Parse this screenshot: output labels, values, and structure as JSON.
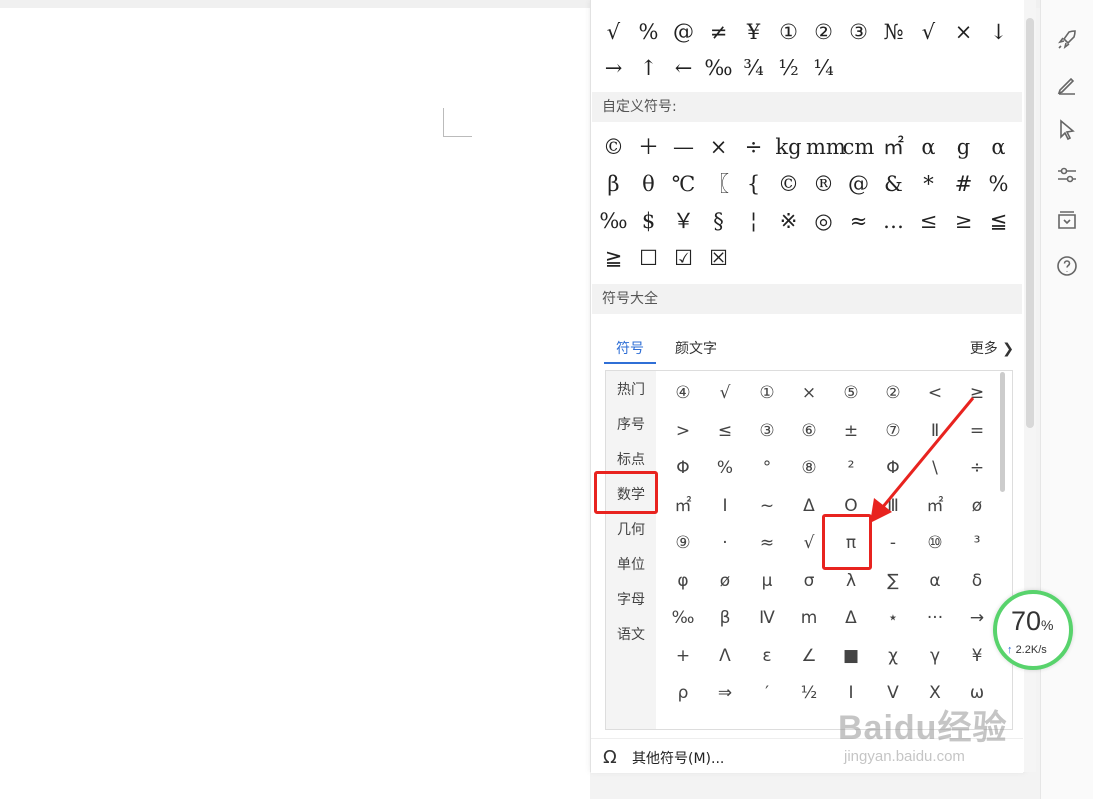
{
  "common_row1": [
    "√",
    "%",
    "@",
    "≠",
    "¥",
    "①",
    "②",
    "③",
    "№",
    "√",
    "×",
    "↓"
  ],
  "common_row2": [
    "→",
    "↑",
    "←",
    "‰",
    "¾",
    "½",
    "¼"
  ],
  "custom_section_title": "自定义符号:",
  "custom_rows": [
    [
      "©",
      "＋",
      "—",
      "×",
      "÷",
      "kg",
      "mm",
      "cm",
      "㎡",
      "α",
      "g",
      "α"
    ],
    [
      "β",
      "θ",
      "℃",
      "〖",
      "{",
      "©",
      "®",
      "@",
      "&",
      "*",
      "#",
      "%"
    ],
    [
      "‰",
      "$",
      "￥",
      "§",
      "¦",
      "※",
      "◎",
      "≈",
      "…",
      "≤",
      "≥",
      "≦"
    ],
    [
      "≧",
      "☐",
      "☑",
      "☒"
    ]
  ],
  "all_section_title": "符号大全",
  "tabs": {
    "symbols": "符号",
    "kaomoji": "颜文字",
    "more": "更多 ❯"
  },
  "categories": [
    "热门",
    "序号",
    "标点",
    "数学",
    "几何",
    "单位",
    "字母",
    "语文"
  ],
  "selected_category": "数学",
  "math_rows": [
    [
      "④",
      "√",
      "①",
      "×",
      "⑤",
      "②",
      "<",
      "≥"
    ],
    [
      ">",
      "≤",
      "③",
      "⑥",
      "±",
      "⑦",
      "Ⅱ",
      "="
    ],
    [
      "Φ",
      "%",
      "°",
      "⑧",
      "²",
      "Φ",
      "\\",
      "÷"
    ],
    [
      "㎡",
      "Ⅰ",
      "~",
      "Δ",
      "Ο",
      "Ⅲ",
      "㎡",
      "ø"
    ],
    [
      "⑨",
      "·",
      "≈",
      "√",
      "π",
      "-",
      "⑩",
      "³"
    ],
    [
      "φ",
      "ø",
      "μ",
      "σ",
      "λ",
      "∑",
      "α",
      "δ"
    ],
    [
      "‰",
      "β",
      "Ⅳ",
      "m",
      "Δ",
      "⋆",
      "···",
      "→"
    ],
    [
      "+",
      "Λ",
      "ε",
      "∠",
      "■",
      "χ",
      "γ",
      "¥"
    ],
    [
      "ρ",
      "⇒",
      "′",
      "½",
      "Ⅰ",
      "Ⅴ",
      "Ⅹ",
      "ω"
    ]
  ],
  "highlighted_symbol": "π",
  "footer": {
    "icon": "Ω",
    "label": "其他符号(M)..."
  },
  "speed": {
    "percent": "70",
    "unit": "%",
    "rate": "2.2K/s"
  },
  "watermark": {
    "brand": "Baidu经验",
    "url": "jingyan.baidu.com"
  },
  "colors": {
    "accent": "#2f6fd6",
    "highlight": "#e8231f",
    "speed_ring": "#58d36c"
  }
}
